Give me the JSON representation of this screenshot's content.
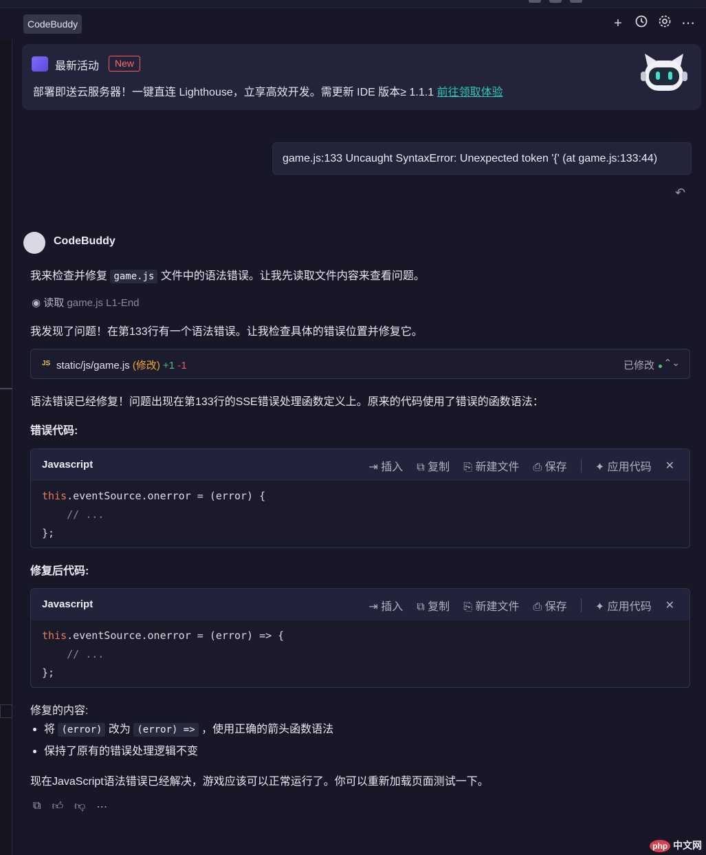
{
  "header": {
    "tab_label": "CodeBuddy",
    "icons": [
      "plus-icon",
      "history-icon",
      "settings-icon",
      "more-icon"
    ]
  },
  "banner": {
    "title": "最新活动",
    "badge": "New",
    "text": "部署即送云服务器！一键直连 Lighthouse，立享高效开发。需更新 IDE 版本≥ 1.1.1 ",
    "link": "前往领取体验"
  },
  "user_message": "game.js:133  Uncaught SyntaxError: Unexpected token '{' (at game.js:133:44)",
  "assistant": {
    "name": "CodeBuddy",
    "intro_before": "我来检查并修复 ",
    "intro_code": "game.js",
    "intro_after": " 文件中的语法错误。让我先读取文件内容来查看问题。",
    "read_action": "读取",
    "read_target": "game.js L1-End",
    "found_text": "我发现了问题！在第133行有一个语法错误。让我检查具体的错误位置并修复它。",
    "file_edit": {
      "icon_label": "JS",
      "path": "static/js/game.js",
      "tag": "(修改)",
      "added": "+1",
      "removed": "-1",
      "status": "已修改"
    },
    "fixed_text": "语法错误已经修复！问题出现在第133行的SSE错误处理函数定义上。原来的代码使用了错误的函数语法：",
    "wrong_heading": "错误代码:",
    "fixed_heading": "修复后代码:",
    "code_actions": {
      "insert": "插入",
      "copy": "复制",
      "new_file": "新建文件",
      "save": "保存",
      "apply": "应用代码"
    },
    "wrong_code": {
      "language": "Javascript",
      "line1_kw": "this",
      "line1_rest": ".eventSource.onerror = (error) {",
      "line2": "    // ...",
      "line3": "};"
    },
    "fixed_code": {
      "language": "Javascript",
      "line1_kw": "this",
      "line1_rest": ".eventSource.onerror = (error) => {",
      "line2": "    // ...",
      "line3": "};"
    },
    "changes_heading": "修复的内容:",
    "bullet1_a": "将 ",
    "bullet1_code1": "(error)",
    "bullet1_b": " 改为 ",
    "bullet1_code2": "(error) =>",
    "bullet1_c": " ，使用正确的箭头函数语法",
    "bullet2": "保持了原有的错误处理逻辑不变",
    "conclusion": "现在JavaScript语法错误已经解决，游戏应该可以正常运行了。你可以重新加载页面测试一下。"
  },
  "watermark": {
    "logo": "php",
    "text": "中文网"
  }
}
